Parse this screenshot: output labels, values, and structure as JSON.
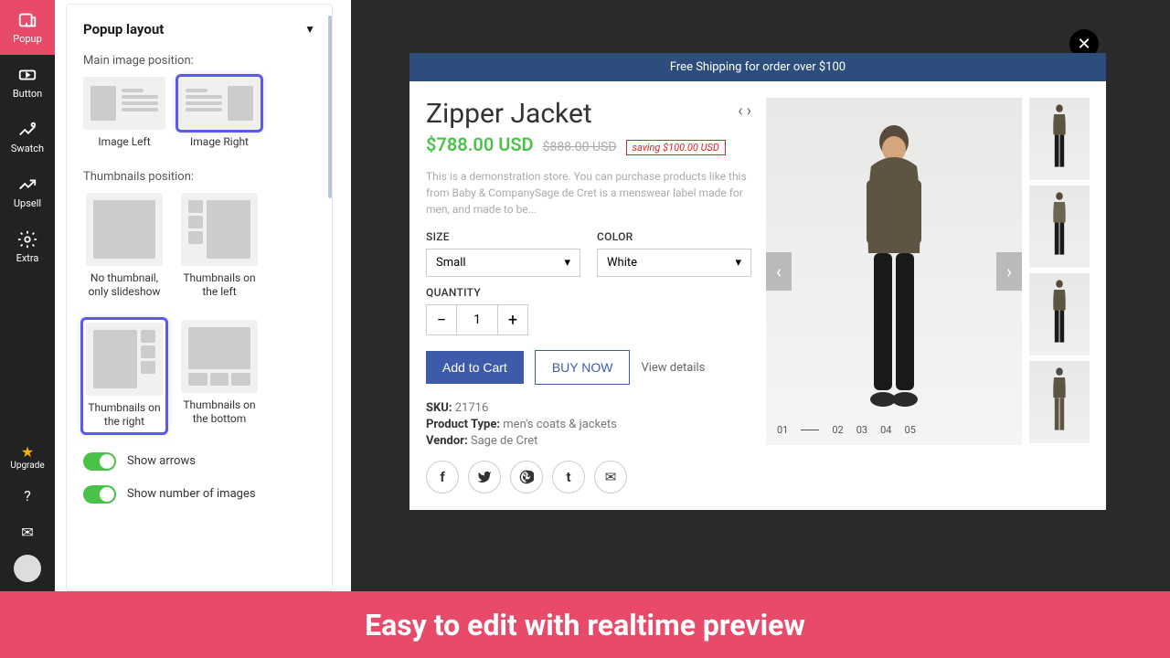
{
  "sidebar": {
    "items": [
      {
        "label": "Popup"
      },
      {
        "label": "Button"
      },
      {
        "label": "Swatch"
      },
      {
        "label": "Upsell"
      },
      {
        "label": "Extra"
      }
    ],
    "upgrade": "Upgrade"
  },
  "config": {
    "section_title": "Popup layout",
    "main_img_label": "Main image position:",
    "main_img_options": [
      {
        "label": "Image Left"
      },
      {
        "label": "Image Right"
      }
    ],
    "thumb_label": "Thumbnails position:",
    "thumb_options": [
      {
        "label": "No thumbnail, only slideshow"
      },
      {
        "label": "Thumbnails on the left"
      },
      {
        "label": "Thumbnails on the right"
      },
      {
        "label": "Thumbnails on the bottom"
      }
    ],
    "show_arrows": "Show arrows",
    "show_number": "Show number of images"
  },
  "preview": {
    "banner": "Free Shipping for order over $100",
    "title": "Zipper Jacket",
    "price": "$788.00 USD",
    "old_price": "$888.00 USD",
    "saving": "saving $100.00 USD",
    "desc": "This is a demonstration store. You can purchase products like this from Baby & CompanySage de Cret is a menswear label made for men, and made to be...",
    "size_label": "SIZE",
    "size_value": "Small",
    "color_label": "COLOR",
    "color_value": "White",
    "qty_label": "QUANTITY",
    "qty_value": "1",
    "add_to_cart": "Add to Cart",
    "buy_now": "BUY NOW",
    "view_details": "View details",
    "sku_label": "SKU:",
    "sku_value": "21716",
    "type_label": "Product Type:",
    "type_value": "men's coats & jackets",
    "vendor_label": "Vendor:",
    "vendor_value": "Sage de Cret",
    "pager": [
      "01",
      "02",
      "03",
      "04",
      "05"
    ]
  },
  "footer": "Easy to edit with realtime preview"
}
